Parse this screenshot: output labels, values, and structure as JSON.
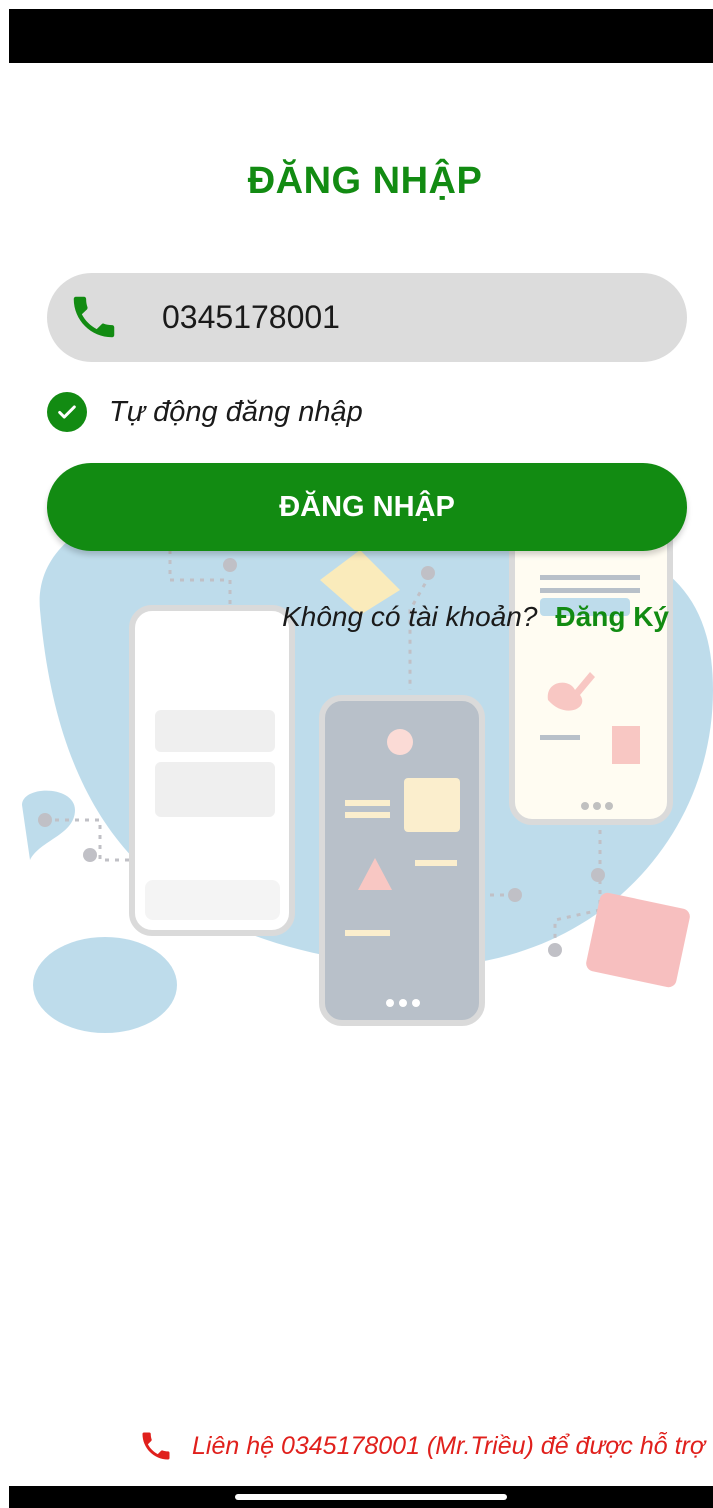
{
  "colors": {
    "brand_green": "#128b12",
    "support_red": "#e0201c",
    "field_gray": "#dcdcdc"
  },
  "login": {
    "title": "ĐĂNG NHẬP",
    "phone_icon": "phone-icon",
    "phone_value": "0345178001",
    "auto_login_checked": true,
    "auto_login_label": "Tự động đăng nhập",
    "submit_label": "ĐĂNG NHẬP",
    "no_account_text": "Không có tài khoản?",
    "register_label": "Đăng Ký"
  },
  "support": {
    "icon": "phone-icon",
    "text": "Liên hệ 0345178001 (Mr.Triều) để được hỗ trợ"
  }
}
